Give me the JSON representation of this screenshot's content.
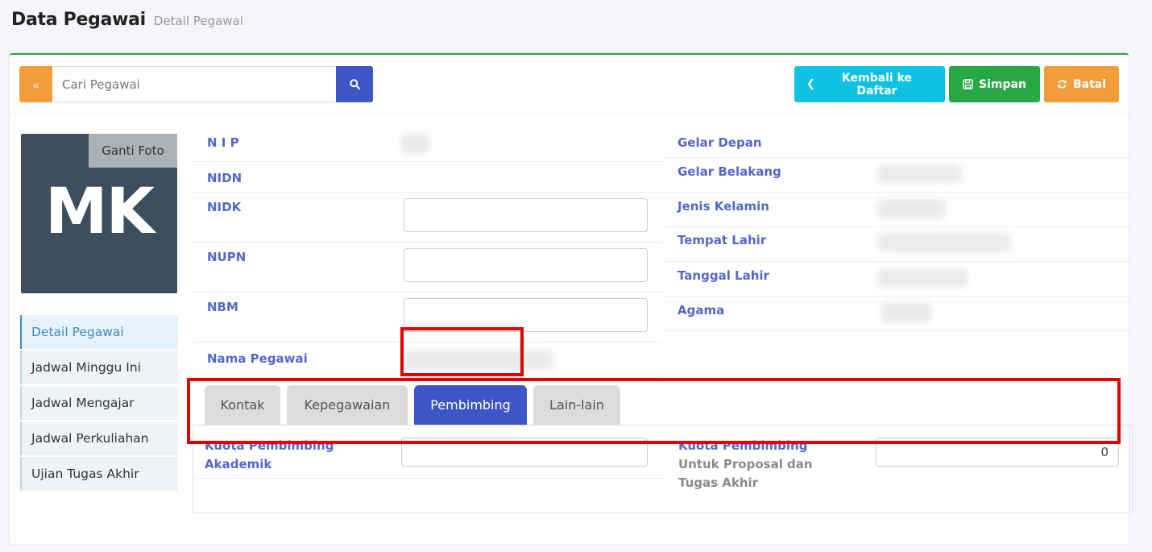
{
  "header": {
    "title": "Data Pegawai",
    "subtitle": "Detail Pegawai"
  },
  "toolbar": {
    "search_placeholder": "Cari Pegawai",
    "toggle_label": "«",
    "back_label": "Kembali ke Daftar",
    "save_label": "Simpan",
    "cancel_label": "Batal"
  },
  "colors": {
    "accent": "#3d56c5",
    "success": "#28a745",
    "info": "#10c1e6",
    "warning": "#f39c3c",
    "highlight": "#e30000"
  },
  "photo": {
    "change_label": "Ganti Foto",
    "initials": "MK"
  },
  "side_menu": {
    "items": [
      {
        "label": "Detail Pegawai",
        "active": true
      },
      {
        "label": "Jadwal Minggu Ini"
      },
      {
        "label": "Jadwal Mengajar"
      },
      {
        "label": "Jadwal Perkuliahan"
      },
      {
        "label": "Ujian Tugas Akhir"
      }
    ]
  },
  "info_left": {
    "nip_label": "N I P",
    "nidn_label": "NIDN",
    "nidk_label": "NIDK",
    "nupn_label": "NUPN",
    "nbm_label": "NBM",
    "nama_label": "Nama Pegawai"
  },
  "info_right": {
    "gelar_depan_label": "Gelar Depan",
    "gelar_belakang_label": "Gelar Belakang",
    "jenis_kelamin_label": "Jenis Kelamin",
    "tempat_lahir_label": "Tempat Lahir",
    "tanggal_lahir_label": "Tanggal Lahir",
    "agama_label": "Agama"
  },
  "tabs": [
    {
      "label": "Kontak"
    },
    {
      "label": "Kepegawaian"
    },
    {
      "label": "Pembimbing",
      "active": true
    },
    {
      "label": "Lain-lain"
    }
  ],
  "pembimbing": {
    "akademik_label_1": "Kuota Pembimbing",
    "akademik_label_2": "Akademik",
    "akademik_value": "",
    "proposal_label_1": "Kuota Pembimbing",
    "proposal_label_2": "Untuk Proposal dan",
    "proposal_label_3": "Tugas Akhir",
    "proposal_value": "0"
  }
}
